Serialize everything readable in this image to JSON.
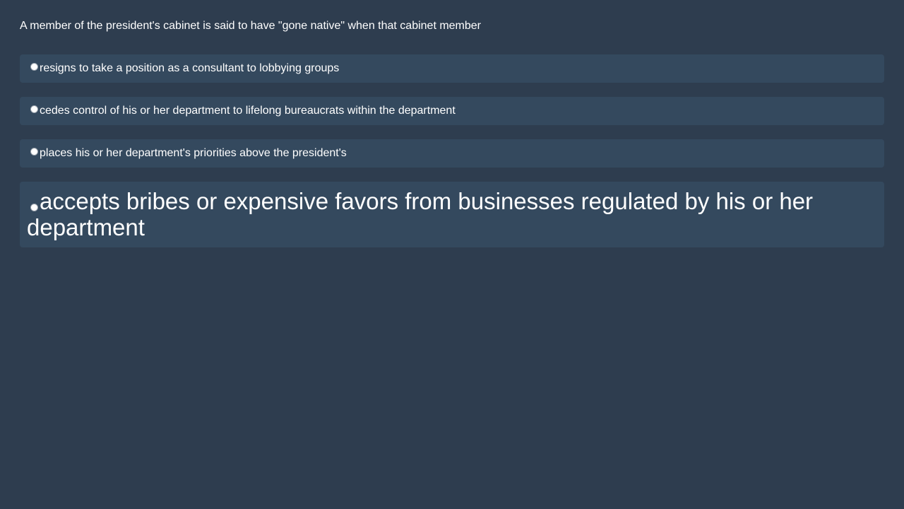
{
  "question": {
    "text": "A member of the president's cabinet is said to have \"gone native\" when that cabinet member"
  },
  "options": [
    {
      "label": "resigns to take a position as a consultant to lobbying groups",
      "selected": false
    },
    {
      "label": "cedes control of his or her department to lifelong bureaucrats within the department",
      "selected": false
    },
    {
      "label": "places his or her department's priorities above the president's",
      "selected": false
    },
    {
      "label": "accepts bribes or expensive favors from businesses regulated by his or her department",
      "selected": false
    }
  ],
  "colors": {
    "background": "#2e3d4f",
    "option_background": "#34495e",
    "text": "#ffffff"
  }
}
